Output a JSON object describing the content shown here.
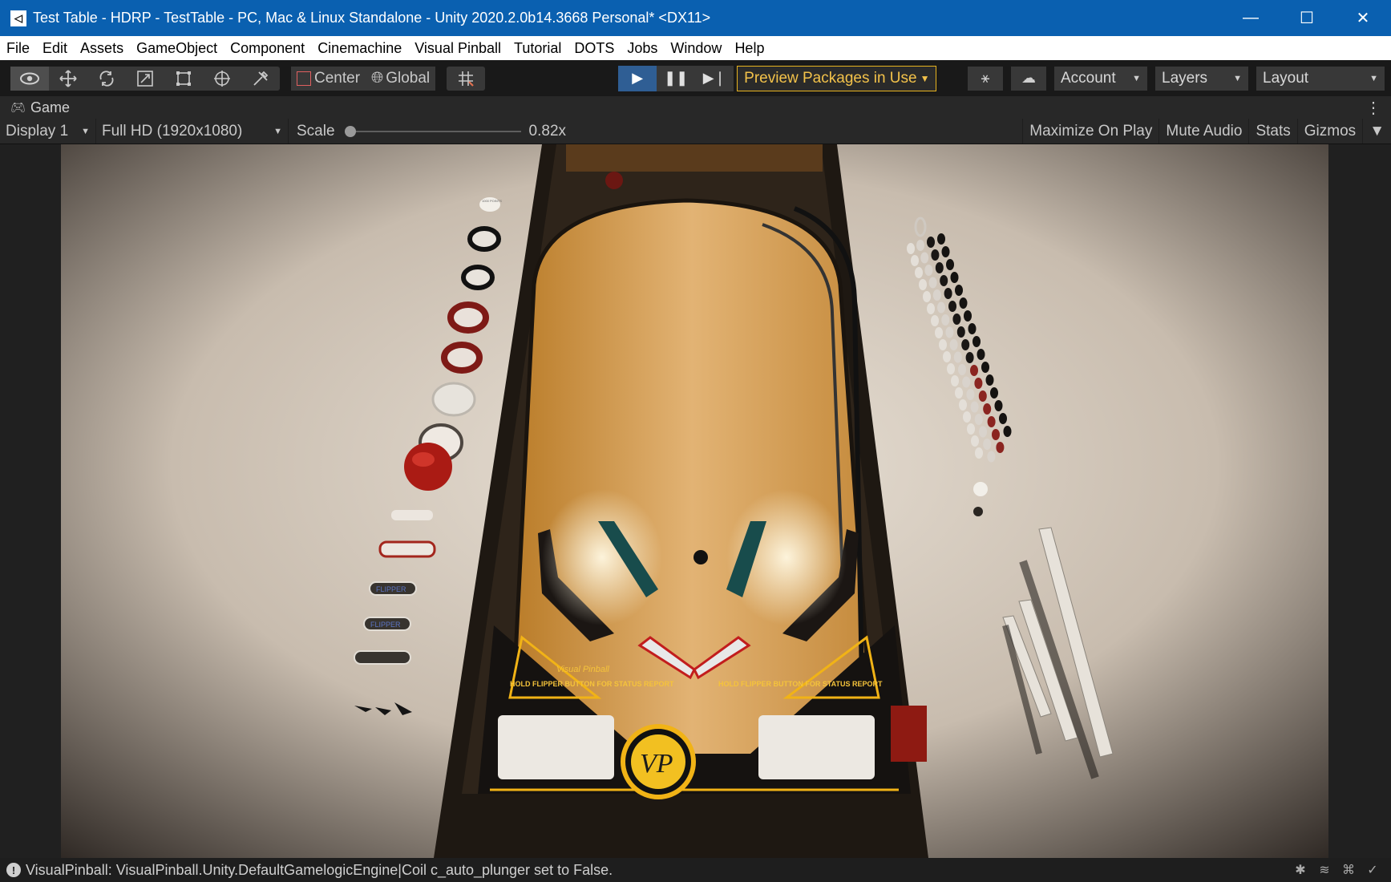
{
  "window": {
    "title": "Test Table - HDRP - TestTable - PC, Mac & Linux Standalone - Unity 2020.2.0b14.3668 Personal* <DX11>",
    "minimize": "—",
    "maximize": "☐",
    "close": "✕"
  },
  "menu": [
    "File",
    "Edit",
    "Assets",
    "GameObject",
    "Component",
    "Cinemachine",
    "Visual Pinball",
    "Tutorial",
    "DOTS",
    "Jobs",
    "Window",
    "Help"
  ],
  "toolbar": {
    "pivot_center": "Center",
    "pivot_global": "Global",
    "preview_packages": "Preview Packages in Use",
    "account": "Account",
    "layers": "Layers",
    "layout": "Layout"
  },
  "game_tab": {
    "title": "Game",
    "display": "Display 1",
    "resolution": "Full HD (1920x1080)",
    "scale_label": "Scale",
    "scale_value": "0.82x",
    "scale_fraction": 0.0,
    "maximize_on_play": "Maximize On Play",
    "mute_audio": "Mute Audio",
    "stats": "Stats",
    "gizmos": "Gizmos"
  },
  "scene": {
    "apron_left": "HOLD FLIPPER BUTTON FOR STATUS REPORT",
    "apron_right": "HOLD FLIPPER BUTTON FOR STATUS REPORT",
    "apron_brand": "Visual Pinball",
    "logo": "VP",
    "bumper_top": "1000 POINTS",
    "flipper_text_1": "FLIPPER",
    "flipper_text_2": "FLIPPER"
  },
  "status": {
    "message": "VisualPinball: VisualPinball.Unity.DefaultGamelogicEngine|Coil c_auto_plunger set to False."
  },
  "colors": {
    "titlebar": "#0a60b0",
    "editor_bg": "#191919",
    "panel": "#282828",
    "play_active": "#2f5e94",
    "preview_border": "#e7b31f"
  }
}
